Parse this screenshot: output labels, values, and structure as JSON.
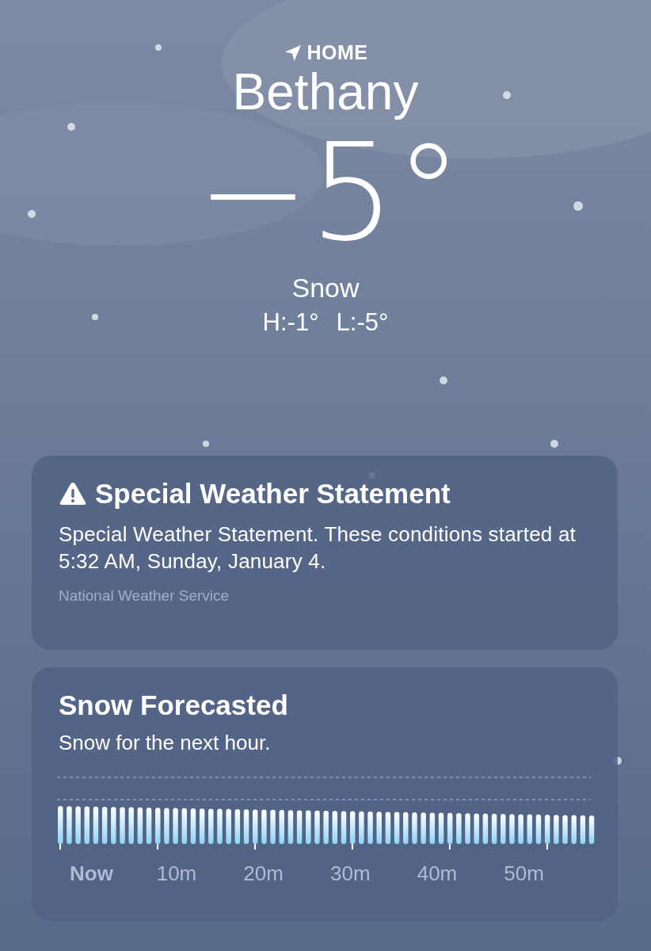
{
  "location": {
    "label": "HOME",
    "city": "Bethany"
  },
  "current": {
    "temperature": "−5°",
    "condition": "Snow",
    "high": "H:-1°",
    "low": "L:-5°"
  },
  "alert": {
    "title": "Special Weather Statement",
    "body": "Special Weather Statement. These conditions started at 5:32 AM, Sunday, January 4.",
    "source": "National Weather Service"
  },
  "precipitation": {
    "title": "Snow Forecasted",
    "summary": "Snow for the next hour.",
    "time_labels": [
      {
        "label": "Now",
        "selected": true
      },
      {
        "label": "10m",
        "selected": false
      },
      {
        "label": "20m",
        "selected": false
      },
      {
        "label": "30m",
        "selected": false
      },
      {
        "label": "40m",
        "selected": false
      },
      {
        "label": "50m",
        "selected": false
      }
    ]
  }
}
